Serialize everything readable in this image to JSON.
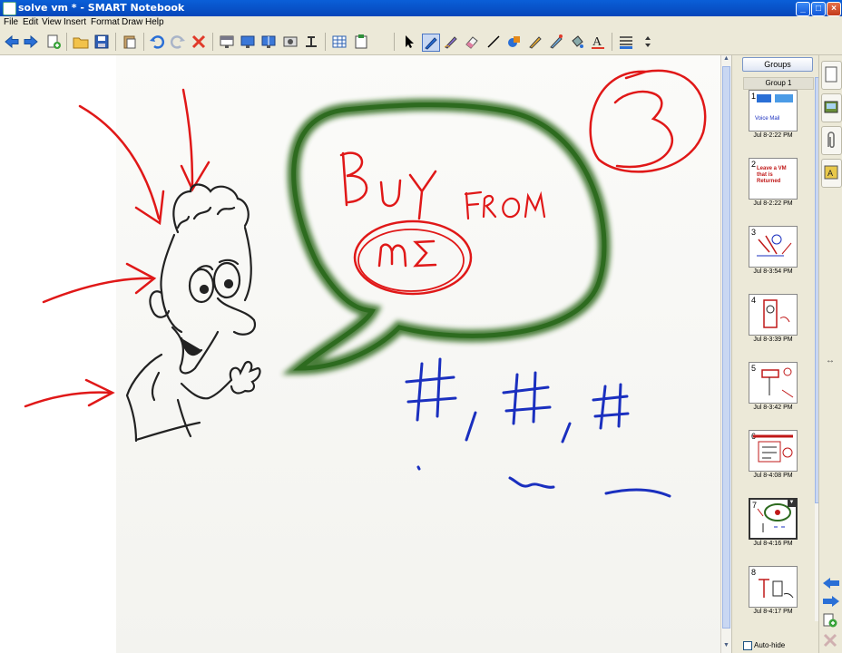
{
  "window": {
    "title": "solve vm * - SMART Notebook"
  },
  "menu": [
    "File",
    "Edit",
    "View",
    "Insert",
    "Format",
    "Draw",
    "Help"
  ],
  "icons": {
    "back": "back-arrow-icon",
    "forward": "forward-arrow-icon",
    "add_page": "add-page-icon",
    "open": "open-folder-icon",
    "save": "save-icon",
    "paste": "paste-icon",
    "undo": "undo-icon",
    "redo": "redo-icon",
    "delete": "delete-icon",
    "screen_shade": "screen-shade-icon",
    "full_screen": "full-screen-icon",
    "dual_page": "dual-page-icon",
    "capture": "screen-capture-icon",
    "doc_camera": "document-camera-icon",
    "table": "table-icon",
    "insert_object": "insert-object-icon",
    "select": "select-arrow-icon",
    "pen": "pen-icon",
    "creative_pen": "creative-pen-icon",
    "eraser": "eraser-icon",
    "line": "line-icon",
    "shapes": "shapes-icon",
    "magic_pen": "magic-pen-icon",
    "recognize": "shape-recognition-pen-icon",
    "fill": "fill-icon",
    "text": "text-icon",
    "properties": "properties-icon",
    "move_toolbar": "move-toolbar-icon"
  },
  "canvas": {
    "words": [
      "BUY",
      "FROM",
      "ME"
    ],
    "circled_number": "3"
  },
  "sidebar": {
    "groups_button": "Groups",
    "group_label": "Group 1",
    "pages": [
      {
        "num": "1",
        "date": "Jul 8-2:22 PM",
        "caption": "Voice Mail"
      },
      {
        "num": "2",
        "date": "Jul 8-2:22 PM",
        "caption": "Leave a VM that is Returned"
      },
      {
        "num": "3",
        "date": "Jul 8-3:54 PM",
        "caption": ""
      },
      {
        "num": "4",
        "date": "Jul 8-3:39 PM",
        "caption": ""
      },
      {
        "num": "5",
        "date": "Jul 8-3:42 PM",
        "caption": ""
      },
      {
        "num": "6",
        "date": "Jul 8-4:08 PM",
        "caption": ""
      },
      {
        "num": "7",
        "date": "Jul 8-4:16 PM",
        "caption": ""
      },
      {
        "num": "8",
        "date": "Jul 8-4:17 PM",
        "caption": ""
      }
    ],
    "auto_hide": "Auto-hide"
  },
  "colors": {
    "title_bar": "#0a5fd8",
    "bubble": "#2d6b1f",
    "ink_red": "#e01818",
    "ink_blue": "#1a2fbf",
    "ink_black": "#222222"
  }
}
